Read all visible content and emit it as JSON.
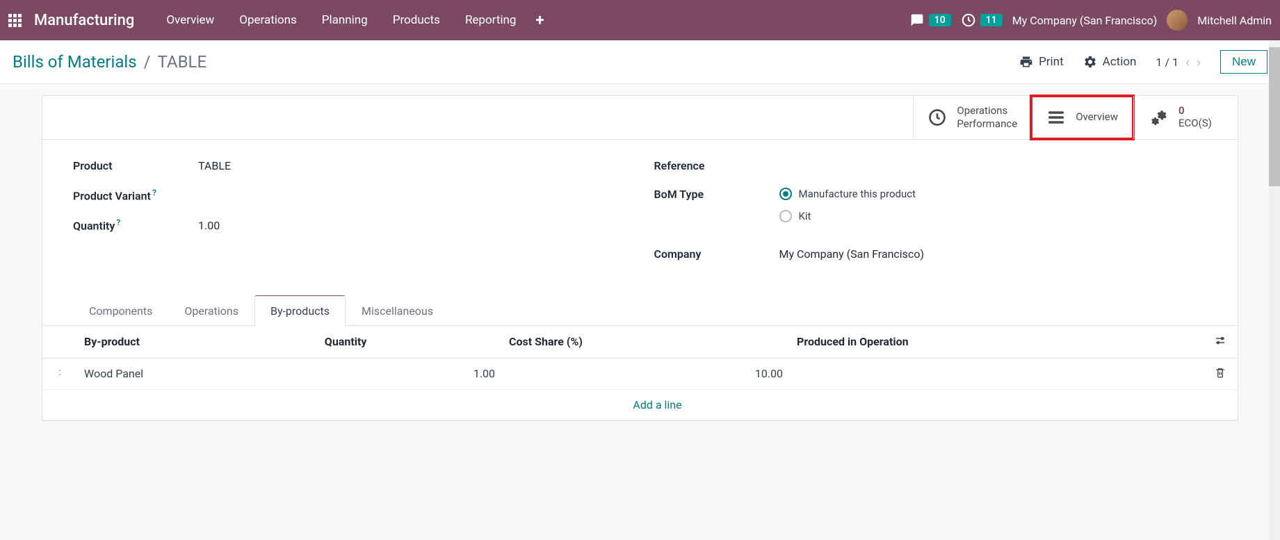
{
  "topnav": {
    "brand": "Manufacturing",
    "links": [
      "Overview",
      "Operations",
      "Planning",
      "Products",
      "Reporting"
    ],
    "messages_count": "10",
    "activities_count": "11",
    "company": "My Company (San Francisco)",
    "user": "Mitchell Admin"
  },
  "breadcrumb": {
    "parent": "Bills of Materials",
    "current": "TABLE",
    "print": "Print",
    "action": "Action",
    "pager": "1 / 1",
    "new": "New"
  },
  "stat_buttons": {
    "ops_perf_l1": "Operations",
    "ops_perf_l2": "Performance",
    "overview": "Overview",
    "ecos_count": "0",
    "ecos_label": "ECO(S)"
  },
  "form": {
    "product_label": "Product",
    "product_value": "TABLE",
    "variant_label": "Product Variant",
    "qty_label": "Quantity",
    "qty_value": "1.00",
    "reference_label": "Reference",
    "bom_type_label": "BoM Type",
    "bom_type_opt1": "Manufacture this product",
    "bom_type_opt2": "Kit",
    "company_label": "Company",
    "company_value": "My Company (San Francisco)"
  },
  "tabs": [
    "Components",
    "Operations",
    "By-products",
    "Miscellaneous"
  ],
  "table": {
    "headers": {
      "byproduct": "By-product",
      "quantity": "Quantity",
      "cost_share": "Cost Share (%)",
      "produced_in": "Produced in Operation"
    },
    "rows": [
      {
        "name": "Wood Panel",
        "qty": "1.00",
        "cost": "10.00",
        "op": ""
      }
    ],
    "add_line": "Add a line"
  }
}
